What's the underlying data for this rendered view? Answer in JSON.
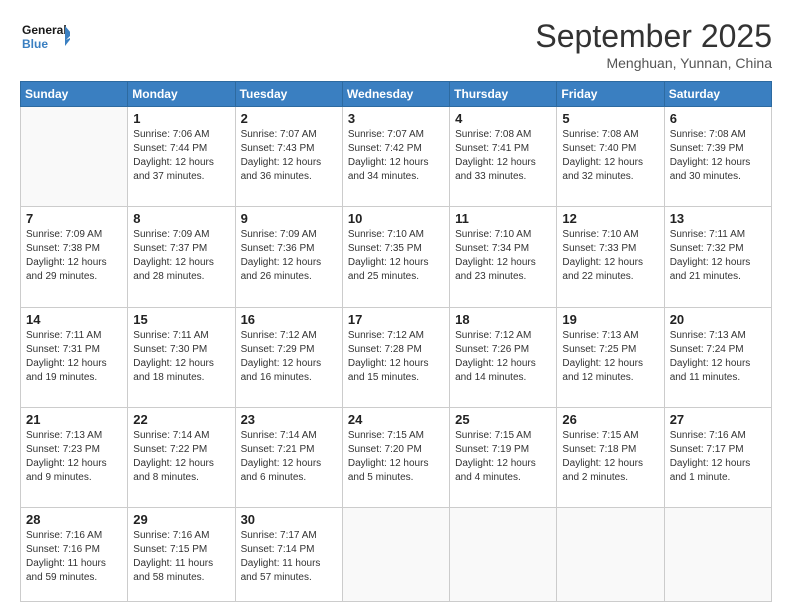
{
  "logo": {
    "line1": "General",
    "line2": "Blue"
  },
  "title": "September 2025",
  "location": "Menghuan, Yunnan, China",
  "days_of_week": [
    "Sunday",
    "Monday",
    "Tuesday",
    "Wednesday",
    "Thursday",
    "Friday",
    "Saturday"
  ],
  "weeks": [
    [
      {
        "day": "",
        "info": ""
      },
      {
        "day": "1",
        "info": "Sunrise: 7:06 AM\nSunset: 7:44 PM\nDaylight: 12 hours\nand 37 minutes."
      },
      {
        "day": "2",
        "info": "Sunrise: 7:07 AM\nSunset: 7:43 PM\nDaylight: 12 hours\nand 36 minutes."
      },
      {
        "day": "3",
        "info": "Sunrise: 7:07 AM\nSunset: 7:42 PM\nDaylight: 12 hours\nand 34 minutes."
      },
      {
        "day": "4",
        "info": "Sunrise: 7:08 AM\nSunset: 7:41 PM\nDaylight: 12 hours\nand 33 minutes."
      },
      {
        "day": "5",
        "info": "Sunrise: 7:08 AM\nSunset: 7:40 PM\nDaylight: 12 hours\nand 32 minutes."
      },
      {
        "day": "6",
        "info": "Sunrise: 7:08 AM\nSunset: 7:39 PM\nDaylight: 12 hours\nand 30 minutes."
      }
    ],
    [
      {
        "day": "7",
        "info": "Sunrise: 7:09 AM\nSunset: 7:38 PM\nDaylight: 12 hours\nand 29 minutes."
      },
      {
        "day": "8",
        "info": "Sunrise: 7:09 AM\nSunset: 7:37 PM\nDaylight: 12 hours\nand 28 minutes."
      },
      {
        "day": "9",
        "info": "Sunrise: 7:09 AM\nSunset: 7:36 PM\nDaylight: 12 hours\nand 26 minutes."
      },
      {
        "day": "10",
        "info": "Sunrise: 7:10 AM\nSunset: 7:35 PM\nDaylight: 12 hours\nand 25 minutes."
      },
      {
        "day": "11",
        "info": "Sunrise: 7:10 AM\nSunset: 7:34 PM\nDaylight: 12 hours\nand 23 minutes."
      },
      {
        "day": "12",
        "info": "Sunrise: 7:10 AM\nSunset: 7:33 PM\nDaylight: 12 hours\nand 22 minutes."
      },
      {
        "day": "13",
        "info": "Sunrise: 7:11 AM\nSunset: 7:32 PM\nDaylight: 12 hours\nand 21 minutes."
      }
    ],
    [
      {
        "day": "14",
        "info": "Sunrise: 7:11 AM\nSunset: 7:31 PM\nDaylight: 12 hours\nand 19 minutes."
      },
      {
        "day": "15",
        "info": "Sunrise: 7:11 AM\nSunset: 7:30 PM\nDaylight: 12 hours\nand 18 minutes."
      },
      {
        "day": "16",
        "info": "Sunrise: 7:12 AM\nSunset: 7:29 PM\nDaylight: 12 hours\nand 16 minutes."
      },
      {
        "day": "17",
        "info": "Sunrise: 7:12 AM\nSunset: 7:28 PM\nDaylight: 12 hours\nand 15 minutes."
      },
      {
        "day": "18",
        "info": "Sunrise: 7:12 AM\nSunset: 7:26 PM\nDaylight: 12 hours\nand 14 minutes."
      },
      {
        "day": "19",
        "info": "Sunrise: 7:13 AM\nSunset: 7:25 PM\nDaylight: 12 hours\nand 12 minutes."
      },
      {
        "day": "20",
        "info": "Sunrise: 7:13 AM\nSunset: 7:24 PM\nDaylight: 12 hours\nand 11 minutes."
      }
    ],
    [
      {
        "day": "21",
        "info": "Sunrise: 7:13 AM\nSunset: 7:23 PM\nDaylight: 12 hours\nand 9 minutes."
      },
      {
        "day": "22",
        "info": "Sunrise: 7:14 AM\nSunset: 7:22 PM\nDaylight: 12 hours\nand 8 minutes."
      },
      {
        "day": "23",
        "info": "Sunrise: 7:14 AM\nSunset: 7:21 PM\nDaylight: 12 hours\nand 6 minutes."
      },
      {
        "day": "24",
        "info": "Sunrise: 7:15 AM\nSunset: 7:20 PM\nDaylight: 12 hours\nand 5 minutes."
      },
      {
        "day": "25",
        "info": "Sunrise: 7:15 AM\nSunset: 7:19 PM\nDaylight: 12 hours\nand 4 minutes."
      },
      {
        "day": "26",
        "info": "Sunrise: 7:15 AM\nSunset: 7:18 PM\nDaylight: 12 hours\nand 2 minutes."
      },
      {
        "day": "27",
        "info": "Sunrise: 7:16 AM\nSunset: 7:17 PM\nDaylight: 12 hours\nand 1 minute."
      }
    ],
    [
      {
        "day": "28",
        "info": "Sunrise: 7:16 AM\nSunset: 7:16 PM\nDaylight: 11 hours\nand 59 minutes."
      },
      {
        "day": "29",
        "info": "Sunrise: 7:16 AM\nSunset: 7:15 PM\nDaylight: 11 hours\nand 58 minutes."
      },
      {
        "day": "30",
        "info": "Sunrise: 7:17 AM\nSunset: 7:14 PM\nDaylight: 11 hours\nand 57 minutes."
      },
      {
        "day": "",
        "info": ""
      },
      {
        "day": "",
        "info": ""
      },
      {
        "day": "",
        "info": ""
      },
      {
        "day": "",
        "info": ""
      }
    ]
  ]
}
